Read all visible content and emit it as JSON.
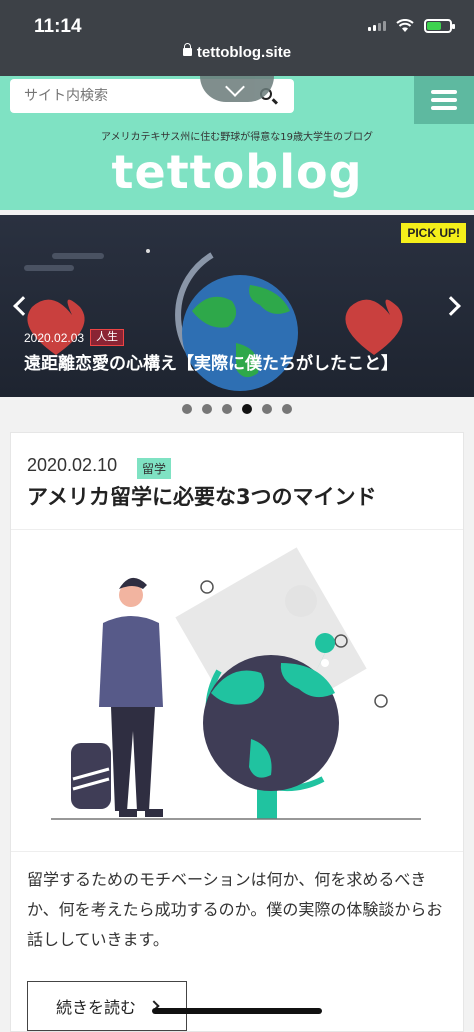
{
  "status_bar": {
    "time": "11:14"
  },
  "browser": {
    "url": "tettoblog.site"
  },
  "header": {
    "search_placeholder": "サイト内検索"
  },
  "site": {
    "tagline": "アメリカテキサス州に住む野球が得意な19歳大学生のブログ",
    "title": "tettoblog"
  },
  "slider": {
    "badge": "PICK UP!",
    "date": "2020.02.03",
    "category": "人生",
    "title": "遠距離恋愛の心構え【実際に僕たちがしたこと】",
    "dot_count": 6,
    "active_dot": 4
  },
  "article": {
    "date": "2020.02.10",
    "category": "留学",
    "title": "アメリカ留学に必要な3つのマインド",
    "excerpt": "留学するためのモチベーションは何か、何を求めるべきか、何を考えたら成功するのか。僕の実際の体験談からお話ししていきます。",
    "read_more": "続きを読む"
  },
  "colors": {
    "accent": "#7fe2c3",
    "accent_dark": "#5eb9a0",
    "pickup": "#f5ef1a",
    "teal_icon": "#20c3a0"
  },
  "icons": [
    "lock-icon",
    "search-icon",
    "menu-icon",
    "chevron-down-icon",
    "chevron-left-icon",
    "chevron-right-icon",
    "chevron-right-icon"
  ]
}
